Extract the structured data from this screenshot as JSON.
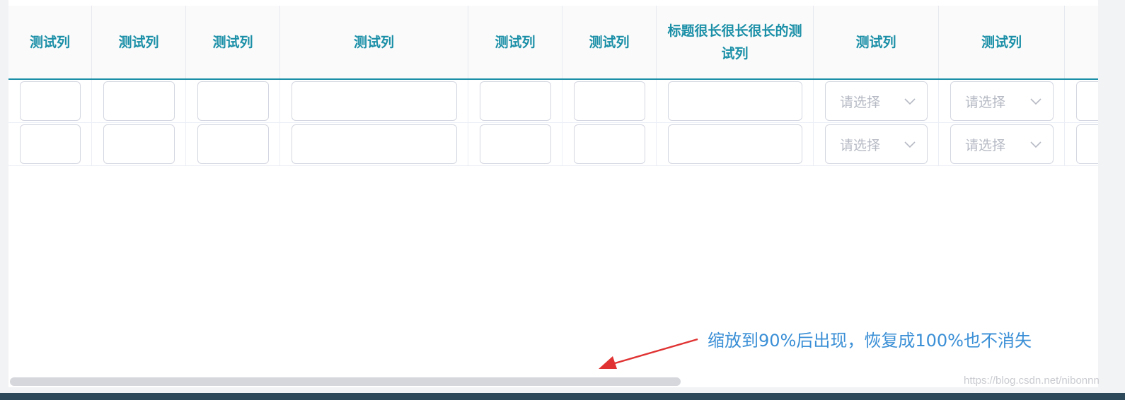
{
  "table": {
    "headers": [
      "测试列",
      "测试列",
      "测试列",
      "测试列",
      "测试列",
      "测试列",
      "标题很长很长很长的测试列",
      "测试列",
      "测试列",
      ""
    ],
    "rows": [
      {
        "inputs": [
          "",
          "",
          "",
          "",
          "",
          "",
          ""
        ],
        "selects": [
          "请选择",
          "请选择"
        ]
      },
      {
        "inputs": [
          "",
          "",
          "",
          "",
          "",
          "",
          ""
        ],
        "selects": [
          "请选择",
          "请选择"
        ]
      }
    ]
  },
  "annotation": {
    "text": "缩放到90%后出现，恢复成100%也不消失"
  },
  "watermark": "https://blog.csdn.net/nibonnn",
  "colors": {
    "header_text": "#1a8fa7",
    "header_border": "#1a8fa7",
    "annotation_text": "#3a8fd6",
    "arrow": "#e03232",
    "placeholder": "#b6bac4"
  },
  "icons": {
    "select_arrow": "chevron-down-icon",
    "annotation_arrow": "arrow-icon"
  }
}
